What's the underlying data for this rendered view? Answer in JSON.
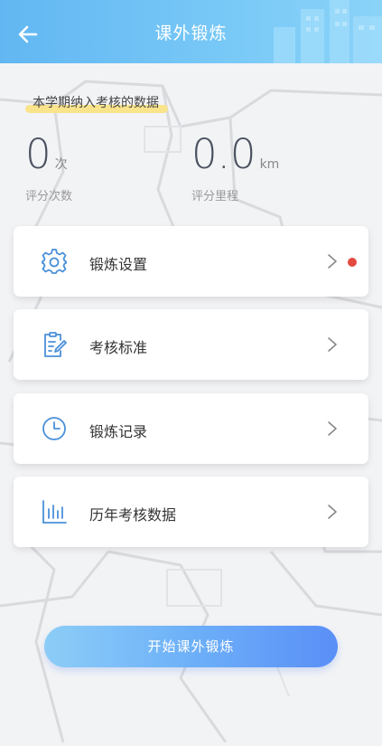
{
  "header": {
    "title": "课外锻炼",
    "back_icon": "arrow-left-icon"
  },
  "stats": {
    "section_label": "本学期纳入考核的数据",
    "count": {
      "value": "0",
      "unit": "次",
      "label": "评分次数"
    },
    "distance": {
      "value": "0.0",
      "unit": "km",
      "label": "评分里程"
    }
  },
  "menu": [
    {
      "label": "锻炼设置",
      "icon": "gear-icon",
      "has_badge": true
    },
    {
      "label": "考核标准",
      "icon": "clipboard-edit-icon",
      "has_badge": false
    },
    {
      "label": "锻炼记录",
      "icon": "clock-icon",
      "has_badge": false
    },
    {
      "label": "历年考核数据",
      "icon": "bar-chart-icon",
      "has_badge": false
    }
  ],
  "start_button": {
    "label": "开始课外锻炼"
  },
  "colors": {
    "accent": "#5a8ff7",
    "header": "#6fc0f5",
    "badge": "#e34a40",
    "icon": "#4a90d9"
  }
}
